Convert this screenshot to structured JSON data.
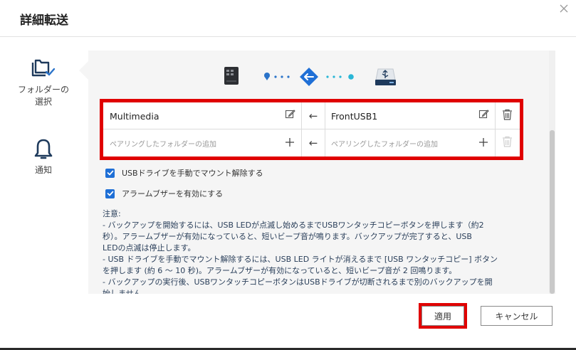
{
  "window": {
    "title": "詳細転送"
  },
  "sidebar": {
    "items": [
      {
        "label_line1": "フォルダーの",
        "label_line2": "選択",
        "icon": "folder-check-icon"
      },
      {
        "label": "通知",
        "icon": "bell-icon"
      }
    ]
  },
  "pairing": {
    "rows": [
      {
        "left_folder": "Multimedia",
        "right_folder": "FrontUSB1"
      },
      {
        "left_placeholder": "ペアリングしたフォルダーの追加",
        "right_placeholder": "ペアリングしたフォルダーの追加"
      }
    ],
    "arrow": "←"
  },
  "options": [
    {
      "label": "USBドライブを手動でマウント解除する",
      "checked": true
    },
    {
      "label": "アラームブザーを有効にする",
      "checked": true
    }
  ],
  "note": {
    "lines": [
      "注意:",
      "- バックアップを開始するには、USB LEDが点滅し始めるまでUSBワンタッチコピーボタンを押します（約2",
      "秒）。アラームブザーが有効になっていると、短いビープ音が鳴ります。バックアップが完了すると、USB",
      "LEDの点滅は停止します。",
      "- USB ドライブを手動でマウント解除するには、USB LED ライトが消えるまで [USB ワンタッチコピー] ボタン",
      "を押します (約 6 ～ 10 秒)。アラームブザーが有効になっていると、短いビープ音が 2 回鳴ります。",
      "- バックアップの実行後、USBワンタッチコピーボタンはUSBドライブが切断されるまで別のバックアップを開",
      "始しません。"
    ]
  },
  "buttons": {
    "apply": "適用",
    "cancel": "キャンセル"
  },
  "colors": {
    "accent": "#1f6fd6",
    "highlight": "#e00000",
    "flow_dot": "#29b6d6"
  }
}
